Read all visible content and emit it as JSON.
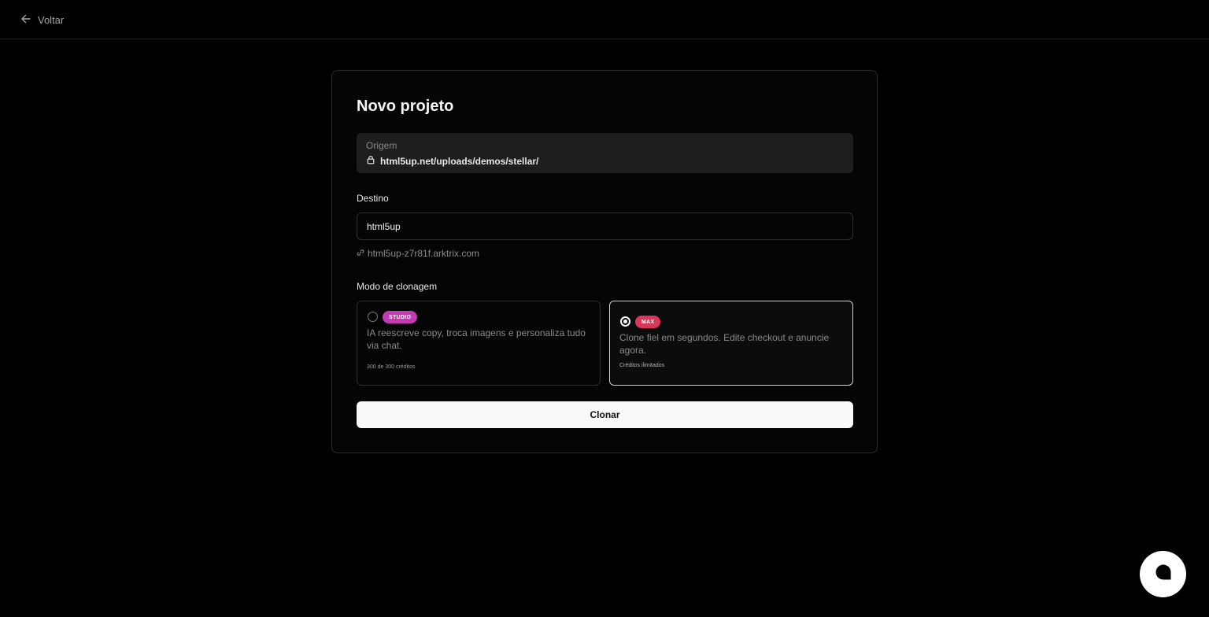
{
  "topbar": {
    "back_label": "Voltar"
  },
  "card": {
    "title": "Novo projeto",
    "origin": {
      "label": "Origem",
      "value": "html5up.net/uploads/demos/stellar/"
    },
    "destination": {
      "label": "Destino",
      "input_value": "html5up",
      "url": "html5up-z7r81f.arktrix.com"
    },
    "mode": {
      "label": "Modo de clonagem",
      "options": [
        {
          "badge": "STUDIO",
          "description": "IA reescreve copy, troca imagens e personaliza tudo via chat.",
          "credits": "300 de 300 créditos",
          "selected": false,
          "badge_color": "#c23bb3"
        },
        {
          "badge": "MAX",
          "description": "Clone fiel em segundos. Edite checkout e anuncie agora.",
          "credits": "Créditos ilimitados",
          "selected": true,
          "badge_color": "#d9365a"
        }
      ]
    },
    "clone_label": "Clonar"
  },
  "icons": {
    "back": "arrow-left-icon",
    "origin": "lock-icon",
    "destination_url": "link-icon",
    "chat": "chat-bubble-icon"
  }
}
